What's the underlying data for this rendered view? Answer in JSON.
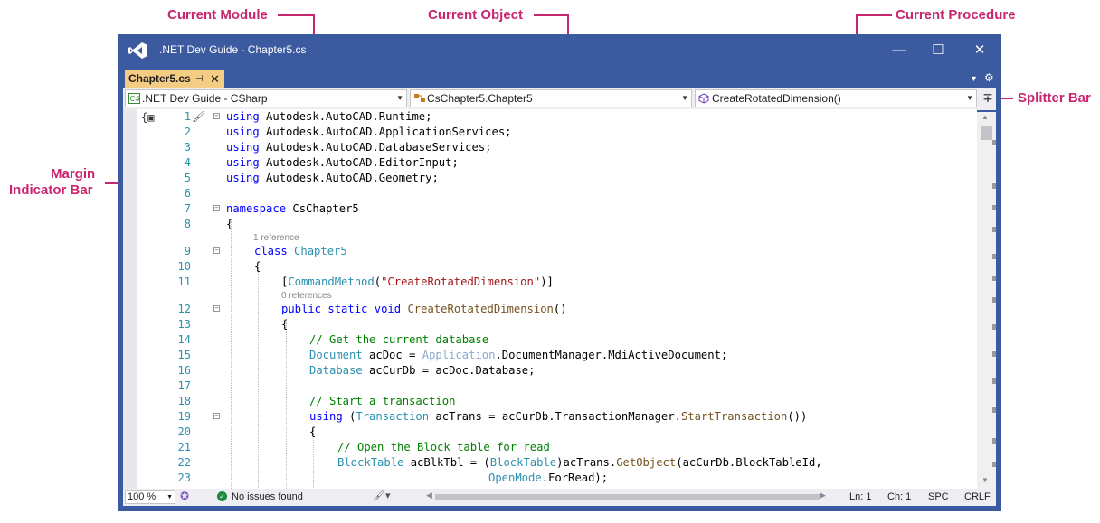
{
  "callouts": {
    "current_module": "Current Module",
    "current_object": "Current Object",
    "current_procedure": "Current Procedure",
    "splitter_bar": "Splitter Bar",
    "margin_indicator_line1": "Margin",
    "margin_indicator_line2": "Indicator Bar"
  },
  "window": {
    "title": ".NET Dev Guide - Chapter5.cs",
    "minimize": "—",
    "maximize": "☐",
    "close": "✕"
  },
  "tab": {
    "label": "Chapter5.cs",
    "pin": "⊣",
    "close": "✕"
  },
  "navbar": {
    "module": ".NET Dev Guide - CSharp",
    "object": "CsChapter5.Chapter5",
    "procedure": "CreateRotatedDimension()"
  },
  "lens": {
    "class_refs": "1 reference",
    "method_refs": "0 references"
  },
  "code_lines": [
    {
      "num": "1"
    },
    {
      "num": "2"
    },
    {
      "num": "3"
    },
    {
      "num": "4"
    },
    {
      "num": "5"
    },
    {
      "num": "6"
    },
    {
      "num": "7"
    },
    {
      "num": "8"
    },
    {
      "num": "9"
    },
    {
      "num": "10"
    },
    {
      "num": "11"
    },
    {
      "num": "12"
    },
    {
      "num": "13"
    },
    {
      "num": "14"
    },
    {
      "num": "15"
    },
    {
      "num": "16"
    },
    {
      "num": "17"
    },
    {
      "num": "18"
    },
    {
      "num": "19"
    },
    {
      "num": "20"
    },
    {
      "num": "21"
    },
    {
      "num": "22"
    },
    {
      "num": "23"
    }
  ],
  "code": {
    "using": "using",
    "ns_runtime": " Autodesk.AutoCAD.Runtime;",
    "ns_appservices": " Autodesk.AutoCAD.ApplicationServices;",
    "ns_dbservices": " Autodesk.AutoCAD.DatabaseServices;",
    "ns_editorinput": " Autodesk.AutoCAD.EditorInput;",
    "ns_geometry": " Autodesk.AutoCAD.Geometry;",
    "namespace_kw": "namespace",
    "namespace_name": " CsChapter5",
    "open_brace": "{",
    "class_kw": "class",
    "class_name": "Chapter5",
    "attr_open": "[",
    "attr_name": "CommandMethod",
    "attr_paren": "(",
    "attr_string": "\"CreateRotatedDimension\"",
    "attr_close": ")]",
    "public_kw": "public",
    "static_kw": "static",
    "void_kw": "void",
    "method_name": "CreateRotatedDimension",
    "method_parens": "()",
    "comment_db": "// Get the current database",
    "document_type": "Document",
    "acdoc_assign": " acDoc = ",
    "application": "Application",
    "docmgr": ".DocumentManager.MdiActiveDocument;",
    "database_type": "Database",
    "accurdb_assign": " acCurDb = acDoc.Database;",
    "comment_trans": "// Start a transaction",
    "using_open": " (",
    "transaction_type": "Transaction",
    "actrans_assign": " acTrans = ",
    "accurdb": "acCurDb",
    "transmgr": ".TransactionManager.",
    "start_trans": "StartTransaction",
    "end_using": "())",
    "comment_block": "// Open the Block table for read",
    "blocktable_type": "BlockTable",
    "acblktbl_assign": " acBlkTbl = (",
    "cast_close": ")acTrans.",
    "getobject": "GetObject",
    "getobject_args": "(acCurDb.BlockTableId,",
    "openmode": "OpenMode",
    "forread": ".ForRead);"
  },
  "statusbar": {
    "zoom": "100 %",
    "issues": "No issues found",
    "ln": "Ln: 1",
    "ch": "Ch: 1",
    "spc": "SPC",
    "crlf": "CRLF"
  },
  "colors": {
    "accent": "#c8266e",
    "window_frame": "#3b5aa0",
    "active_tab": "#f5cc84",
    "keyword": "#0000ff",
    "type": "#2b91af",
    "string": "#a31515",
    "comment": "#008000"
  }
}
